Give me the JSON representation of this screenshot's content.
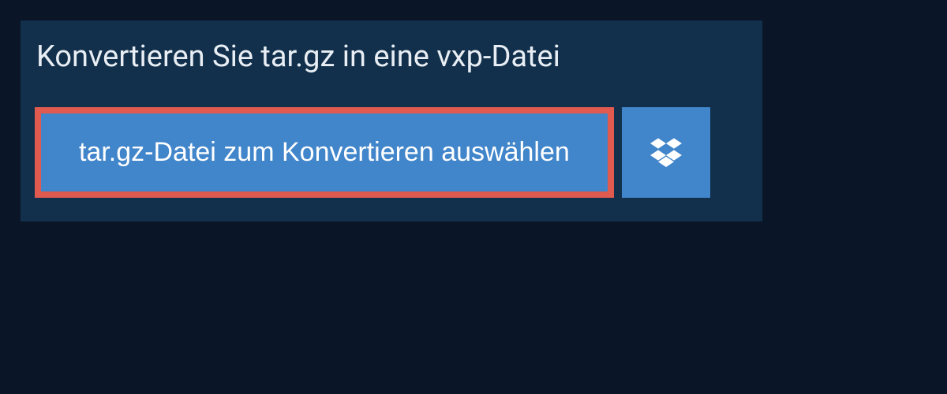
{
  "heading": "Konvertieren Sie tar.gz in eine vxp-Datei",
  "main_button_label": "tar.gz-Datei zum Konvertieren auswählen",
  "colors": {
    "background": "#0a1628",
    "panel": "#12304c",
    "button": "#4185ca",
    "highlight": "#e05a4f",
    "text_heading": "#e8eef4",
    "text_button": "#ffffff"
  }
}
